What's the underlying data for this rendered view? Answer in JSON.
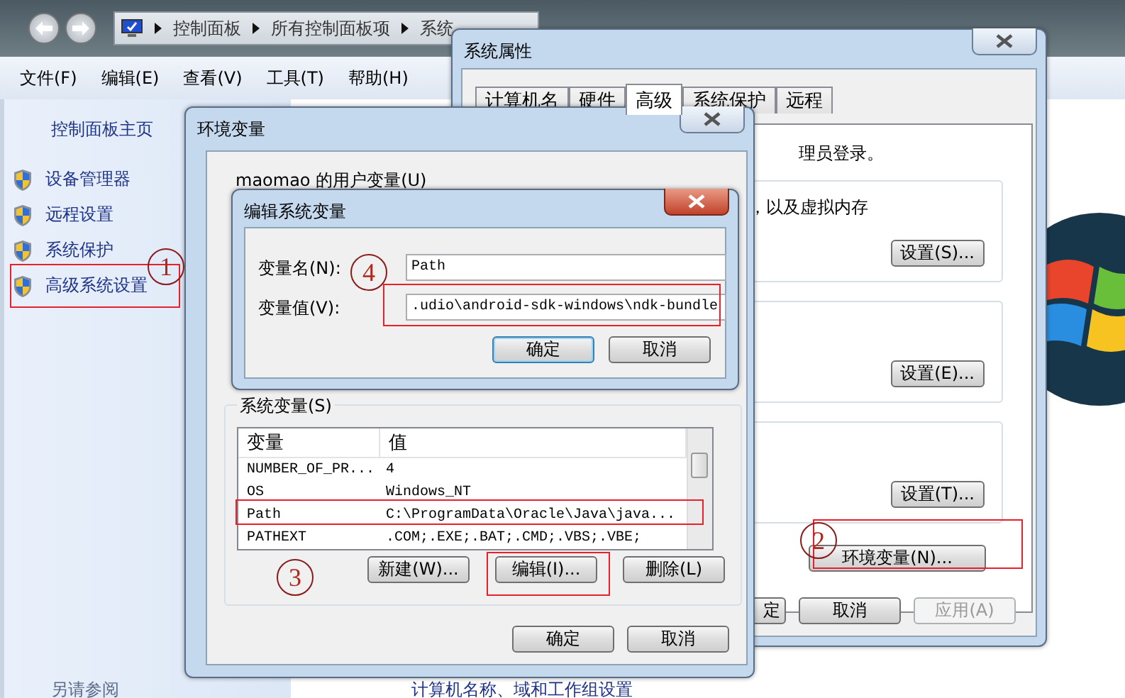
{
  "explorer": {
    "breadcrumb": [
      "控制面板",
      "所有控制面板项",
      "系统"
    ],
    "menu": [
      "文件(F)",
      "编辑(E)",
      "查看(V)",
      "工具(T)",
      "帮助(H)"
    ],
    "sidebar": {
      "home": "控制面板主页",
      "items": [
        "设备管理器",
        "远程设置",
        "系统保护",
        "高级系统设置"
      ],
      "see_also": "另请参阅"
    },
    "content_heading": "计算机名称、域和工作组设置"
  },
  "system_properties": {
    "title": "系统属性",
    "tabs": [
      {
        "label": "计算机名",
        "selected": false
      },
      {
        "label": "硬件",
        "selected": false
      },
      {
        "label": "高级",
        "selected": true
      },
      {
        "label": "系统保护",
        "selected": false
      },
      {
        "label": "远程",
        "selected": false
      }
    ],
    "notice": "理员登录。",
    "groups": [
      {
        "text": "，以及虚拟内存",
        "button": "设置(S)..."
      },
      {
        "button": "设置(E)..."
      },
      {
        "button": "设置(T)..."
      }
    ],
    "env_button": "环境变量(N)...",
    "buttons": [
      {
        "label": "定",
        "disabled": false
      },
      {
        "label": "取消",
        "disabled": false
      },
      {
        "label": "应用(A)",
        "disabled": true
      }
    ]
  },
  "environment_variables": {
    "title": "环境变量",
    "user_group": "maomao 的用户变量(U)",
    "system_group": "系统变量(S)",
    "columns": [
      "变量",
      "值"
    ],
    "rows": [
      {
        "name": "NUMBER_OF_PR...",
        "value": "4"
      },
      {
        "name": "OS",
        "value": "Windows_NT"
      },
      {
        "name": "Path",
        "value": "C:\\ProgramData\\Oracle\\Java\\java..."
      },
      {
        "name": "PATHEXT",
        "value": ".COM;.EXE;.BAT;.CMD;.VBS;.VBE;"
      }
    ],
    "list_buttons": [
      "新建(W)...",
      "编辑(I)...",
      "删除(L)"
    ],
    "buttons": [
      "确定",
      "取消"
    ]
  },
  "edit_dialog": {
    "title": "编辑系统变量",
    "name_label": "变量名(N):",
    "name_value": "Path",
    "value_label": "变量值(V):",
    "value_value": ".udio\\android-sdk-windows\\ndk-bundle",
    "buttons": [
      {
        "label": "确定",
        "default": true
      },
      {
        "label": "取消",
        "default": false
      }
    ]
  },
  "annotations": [
    "1",
    "2",
    "3",
    "4"
  ]
}
